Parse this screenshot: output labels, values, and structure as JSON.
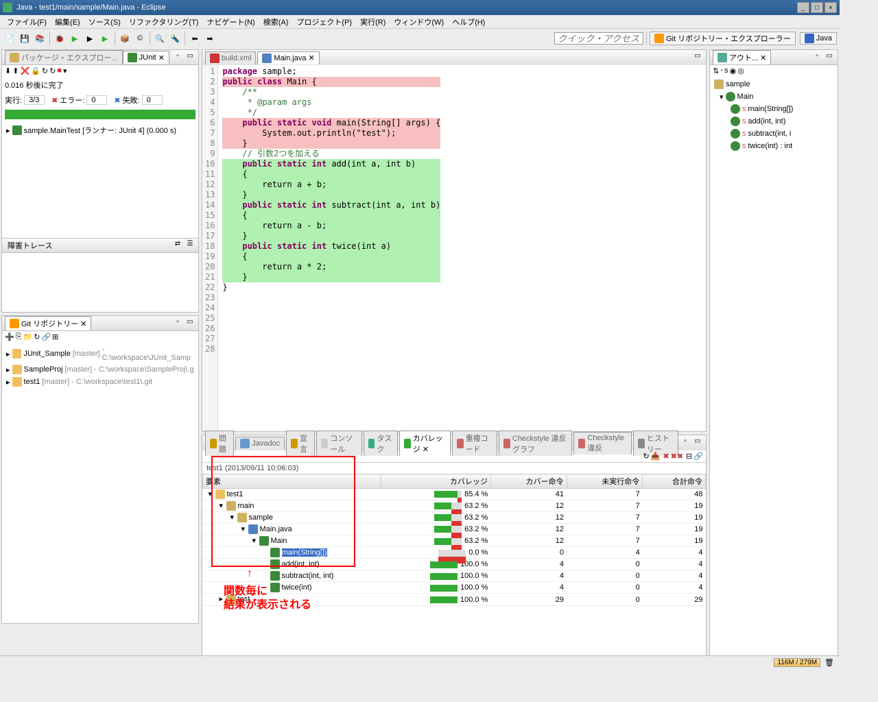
{
  "title": "Java - test1/main/sample/Main.java - Eclipse",
  "menu": [
    "ファイル(F)",
    "編集(E)",
    "ソース(S)",
    "リファクタリング(T)",
    "ナビゲート(N)",
    "検索(A)",
    "プロジェクト(P)",
    "実行(R)",
    "ウィンドウ(W)",
    "ヘルプ(H)"
  ],
  "quick_access": "クイック・アクセス",
  "perspectives": {
    "git": "Git リポジトリー・エクスプローラー",
    "java": "Java"
  },
  "left": {
    "pkg_title": "パッケージ・エクスプロー...",
    "junit_title": "JUnit",
    "junit_status": "0.016 秒後に完了",
    "junit_runs_label": "実行:",
    "junit_runs": "3/3",
    "junit_err_label": "エラー:",
    "junit_err": "0",
    "junit_fail_label": "失敗:",
    "junit_fail": "0",
    "junit_tree": "sample.MainTest [ランナー: JUnit 4] (0.000 s)",
    "failure_trace": "障害トレース",
    "git_title": "Git リポジトリー",
    "git_repos": [
      {
        "name": "JUnit_Sample",
        "branch": "[master]",
        "path": " - C:\\workspace\\JUnit_Samp"
      },
      {
        "name": "SampleProj",
        "branch": "[master]",
        "path": " - C:\\workspace\\SampleProj\\.g"
      },
      {
        "name": "test1",
        "branch": "[master]",
        "path": " - C:\\workspace\\test1\\.git"
      }
    ]
  },
  "editor": {
    "tabs": [
      "build.xml",
      "Main.java"
    ],
    "lines": [
      {
        "n": 1,
        "t": "package",
        "c": " sample;"
      },
      {
        "n": 2,
        "t": "",
        "c": ""
      },
      {
        "n": 3,
        "t": "public class",
        "c": " Main {",
        "hl": "red"
      },
      {
        "n": 4,
        "t": "",
        "c": ""
      },
      {
        "n": 5,
        "t": "",
        "c": "    /**",
        "com": true
      },
      {
        "n": 6,
        "t": "",
        "c": "     * @param args",
        "com": true
      },
      {
        "n": 7,
        "t": "",
        "c": "     */",
        "com": true
      },
      {
        "n": 8,
        "t": "    public static void",
        "c": " main(String[] args) {",
        "hl": "red"
      },
      {
        "n": 9,
        "t": "",
        "c": "        System.out.println(\"test\");",
        "hl": "red"
      },
      {
        "n": 10,
        "t": "",
        "c": "    }",
        "hl": "red"
      },
      {
        "n": 11,
        "t": "",
        "c": ""
      },
      {
        "n": 12,
        "t": "",
        "c": "    // 引数2つを加える",
        "com": true
      },
      {
        "n": 13,
        "t": "    public static int",
        "c": " add(int a, int b)",
        "hl": "grn"
      },
      {
        "n": 14,
        "t": "",
        "c": "    {",
        "hl": "grn"
      },
      {
        "n": 15,
        "t": "",
        "c": "        return a + b;",
        "hl": "grn"
      },
      {
        "n": 16,
        "t": "",
        "c": "    }",
        "hl": "grn"
      },
      {
        "n": 17,
        "t": "",
        "c": ""
      },
      {
        "n": 18,
        "t": "    public static int",
        "c": " subtract(int a, int b)",
        "hl": "grn"
      },
      {
        "n": 19,
        "t": "",
        "c": "    {",
        "hl": "grn"
      },
      {
        "n": 20,
        "t": "",
        "c": "        return a - b;",
        "hl": "grn"
      },
      {
        "n": 21,
        "t": "",
        "c": "    }",
        "hl": "grn"
      },
      {
        "n": 22,
        "t": "",
        "c": ""
      },
      {
        "n": 23,
        "t": "    public static int",
        "c": " twice(int a)",
        "hl": "grn"
      },
      {
        "n": 24,
        "t": "",
        "c": "    {",
        "hl": "grn"
      },
      {
        "n": 25,
        "t": "",
        "c": "        return a * 2;",
        "hl": "grn"
      },
      {
        "n": 26,
        "t": "",
        "c": "    }",
        "hl": "grn"
      },
      {
        "n": 27,
        "t": "",
        "c": "}"
      },
      {
        "n": 28,
        "t": "",
        "c": ""
      }
    ]
  },
  "bottom": {
    "tabs": [
      "問題",
      "Javadoc",
      "宣言",
      "コンソール",
      "タスク",
      "カバレッジ",
      "重複コード",
      "Checkstyle 違反グラフ",
      "Checkstyle 違反",
      "ヒストリー"
    ],
    "active_tab": 5,
    "session": "test1 (2013/09/11 10:06:03)",
    "cols": [
      "要素",
      "カバレッジ",
      "カバー命令",
      "未実行命令",
      "合計命令"
    ],
    "rows": [
      {
        "indent": 0,
        "exp": "-",
        "ic": "#f0c060",
        "name": "test1",
        "cov": 85.4,
        "cov_i": 41,
        "miss": 7,
        "tot": 48
      },
      {
        "indent": 1,
        "exp": "-",
        "ic": "#d0b060",
        "name": "main",
        "cov": 63.2,
        "cov_i": 12,
        "miss": 7,
        "tot": 19
      },
      {
        "indent": 2,
        "exp": "-",
        "ic": "#d0b060",
        "name": "sample",
        "cov": 63.2,
        "cov_i": 12,
        "miss": 7,
        "tot": 19
      },
      {
        "indent": 3,
        "exp": "-",
        "ic": "#5080c0",
        "name": "Main.java",
        "cov": 63.2,
        "cov_i": 12,
        "miss": 7,
        "tot": 19
      },
      {
        "indent": 4,
        "exp": "-",
        "ic": "#3a8a3a",
        "name": "Main",
        "cov": 63.2,
        "cov_i": 12,
        "miss": 7,
        "tot": 19
      },
      {
        "indent": 5,
        "exp": "",
        "ic": "#3a8a3a",
        "name": "main(String[])",
        "sel": true,
        "cov": 0.0,
        "cov_i": 0,
        "miss": 4,
        "tot": 4
      },
      {
        "indent": 5,
        "exp": "",
        "ic": "#3a8a3a",
        "name": "add(int, int)",
        "cov": 100.0,
        "cov_i": 4,
        "miss": 0,
        "tot": 4
      },
      {
        "indent": 5,
        "exp": "",
        "ic": "#3a8a3a",
        "name": "subtract(int, int)",
        "cov": 100.0,
        "cov_i": 4,
        "miss": 0,
        "tot": 4
      },
      {
        "indent": 5,
        "exp": "",
        "ic": "#3a8a3a",
        "name": "twice(int)",
        "cov": 100.0,
        "cov_i": 4,
        "miss": 0,
        "tot": 4
      },
      {
        "indent": 1,
        "exp": "+",
        "ic": "#d0b060",
        "name": "test",
        "cov": 100.0,
        "cov_i": 29,
        "miss": 0,
        "tot": 29
      }
    ]
  },
  "outline": {
    "title": "アウト...",
    "pkg": "sample",
    "class": "Main",
    "methods": [
      "main(String[])",
      "add(int, int)",
      "subtract(int, i",
      "twice(int) : int"
    ]
  },
  "status": {
    "mem": "116M / 279M"
  },
  "annotation": {
    "arrow": "↑",
    "line1": "関数毎に",
    "line2": "結果が表示される"
  }
}
